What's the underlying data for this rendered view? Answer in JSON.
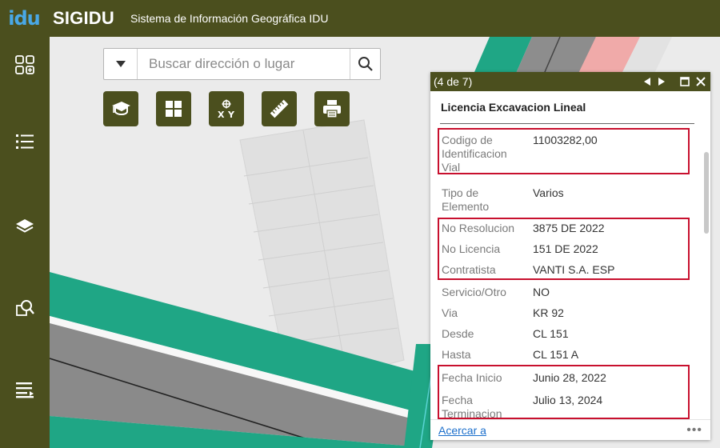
{
  "header": {
    "logo_text": "idu",
    "title": "SIGIDU",
    "subtitle": "Sistema de Información Geográfica IDU"
  },
  "sidebar": {
    "items": [
      {
        "icon": "widgets-icon"
      },
      {
        "icon": "list-icon"
      },
      {
        "icon": "layers-icon"
      },
      {
        "icon": "query-icon"
      },
      {
        "icon": "attribute-table-icon"
      }
    ]
  },
  "search": {
    "placeholder": "Buscar dirección o lugar"
  },
  "tools": [
    {
      "icon": "graduation-cap-icon"
    },
    {
      "icon": "grid-icon"
    },
    {
      "icon": "xy-coordinates-icon"
    },
    {
      "icon": "ruler-icon"
    },
    {
      "icon": "print-icon"
    }
  ],
  "popup": {
    "count": "(4 de 7)",
    "title": "Licencia Excavacion Lineal",
    "fields": [
      {
        "label": "Codigo de Identificacion Vial",
        "value": "11003282,00"
      },
      {
        "label": "Tipo de Elemento",
        "value": "Varios"
      },
      {
        "label": "No Resolucion",
        "value": "3875 DE 2022"
      },
      {
        "label": "No Licencia",
        "value": "151 DE 2022"
      },
      {
        "label": "Contratista",
        "value": "VANTI S.A. ESP"
      },
      {
        "label": "Servicio/Otro",
        "value": "NO"
      },
      {
        "label": "Via",
        "value": "KR 92"
      },
      {
        "label": "Desde",
        "value": "CL 151"
      },
      {
        "label": "Hasta",
        "value": "CL 151 A"
      },
      {
        "label": "Fecha Inicio",
        "value": "Junio 28, 2022"
      },
      {
        "label": "Fecha Terminacion",
        "value": "Julio 13, 2024"
      }
    ],
    "zoom_label": "Acercar a",
    "more_label": "•••"
  },
  "colors": {
    "brand": "#4b4f1e",
    "highlight": "#c8102e",
    "link": "#1a6ecb",
    "road_green": "#1fa685",
    "road_gray": "#8a8a8a"
  }
}
